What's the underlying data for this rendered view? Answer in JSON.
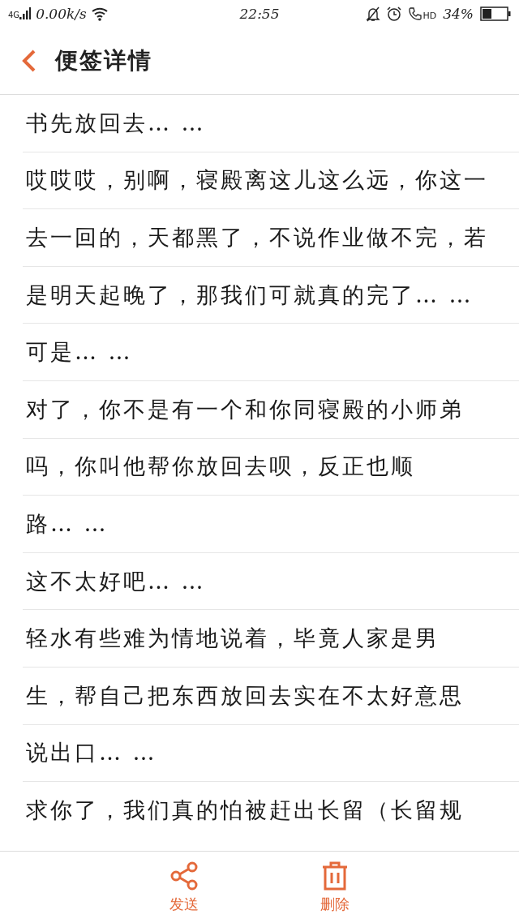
{
  "status_bar": {
    "network": "4G",
    "speed": "0.00k/s",
    "time": "22:55",
    "call_badge": "HD",
    "battery": "34%"
  },
  "header": {
    "title": "便签详情"
  },
  "note_lines": [
    "书先放回去… …",
    "哎哎哎，别啊，寝殿离这儿这么远，你这一",
    "去一回的，天都黑了，不说作业做不完，若",
    "是明天起晚了，那我们可就真的完了… …",
    "可是… …",
    "对了，你不是有一个和你同寝殿的小师弟",
    "吗，你叫他帮你放回去呗，反正也顺",
    "路… …",
    "这不太好吧… …",
    "轻水有些难为情地说着，毕竟人家是男",
    "生，帮自己把东西放回去实在不太好意思",
    "说出口… …",
    "求你了，我们真的怕被赶出长留（长留规"
  ],
  "toolbar": [
    {
      "kind": "share",
      "label": "发送"
    },
    {
      "kind": "delete",
      "label": "删除"
    }
  ]
}
